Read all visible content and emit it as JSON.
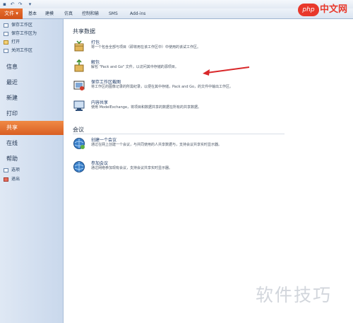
{
  "quick_access": [
    "save-icon",
    "undo-icon",
    "redo-icon",
    "customize-icon"
  ],
  "ribbon": {
    "file_tab": "文件",
    "tabs": [
      "基本",
      "建模",
      "仿真",
      "控制和输",
      "SMS",
      "Add-ins"
    ]
  },
  "backstage": {
    "top_items": [
      {
        "label": "保存工作区",
        "icon": "save-icon"
      },
      {
        "label": "保存工作区为",
        "icon": "save-as-icon"
      },
      {
        "label": "打开",
        "icon": "open-folder-icon"
      },
      {
        "label": "关闭工作区",
        "icon": "close-document-icon"
      }
    ],
    "sections": [
      "信息",
      "最近",
      "新建",
      "打印",
      "共享",
      "在线",
      "帮助"
    ],
    "bottom_items": [
      {
        "label": "选项",
        "icon": "options-icon"
      },
      {
        "label": "退出",
        "icon": "exit-icon"
      }
    ]
  },
  "main": {
    "share_section": {
      "title": "共享数据",
      "items": [
        {
          "title": "打包",
          "desc": "将一个包含全部与项目（即将用在该工作区中）中使用的该试工作区。",
          "icon": "package-icon"
        },
        {
          "title": "解包",
          "desc": "解包 \"Pack and Go\" 文件，以访问其中存储的源项目。",
          "icon": "unpack-icon"
        },
        {
          "title": "保存工作区截图",
          "desc": "将工作区的图像记录的所需纪录，以便在其中存储，Pack and Go，的文件中输出工作区。",
          "icon": "screenshot-icon"
        },
        {
          "title": "内容共享",
          "desc": "使用 ModelExchange，将项目和数据共享的数据在所有的共享数据。",
          "icon": "content-share-icon"
        }
      ]
    },
    "meeting_section": {
      "title": "会议",
      "items": [
        {
          "title": "创建一个会议",
          "desc": "通过在网上创建一个会议，与共同使用的人共享数据与，支持会议共享实时显示器。",
          "icon": "create-meeting-icon"
        },
        {
          "title": "参加会议",
          "desc": "通过网络参加现有会议，支持会议共享实时显示器。",
          "icon": "join-meeting-icon"
        }
      ]
    }
  },
  "watermark": {
    "logo_badge": "php",
    "logo_text": "中文网",
    "bottom": "软件技巧"
  },
  "colors": {
    "file_tab": "#d95f23",
    "selected_section": "#e8702f",
    "left_pane": "#d4e0ef",
    "annotation_arrow": "#d9282a"
  }
}
